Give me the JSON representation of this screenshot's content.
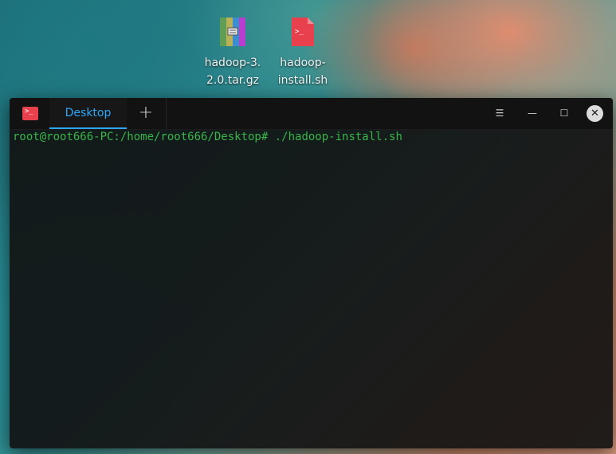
{
  "desktop": {
    "icons": [
      {
        "label": "hadoop-3.\n2.0.tar.gz",
        "icon": "archive-icon"
      },
      {
        "label": "hadoop-\ninstall.sh",
        "icon": "shell-script-icon"
      }
    ]
  },
  "terminal": {
    "app_icon_text": ">_",
    "tab_label": "Desktop",
    "new_tab_glyph": "+",
    "menu_glyph": "☰",
    "minimize_glyph": "—",
    "maximize_glyph": "☐",
    "close_glyph": "✕",
    "prompt": "root@root666-PC:/home/root666/Desktop#",
    "command": " ./hadoop-install.sh"
  },
  "colors": {
    "accent": "#2ca7f8",
    "prompt_green": "#39b54a",
    "app_red": "#e8414d"
  }
}
